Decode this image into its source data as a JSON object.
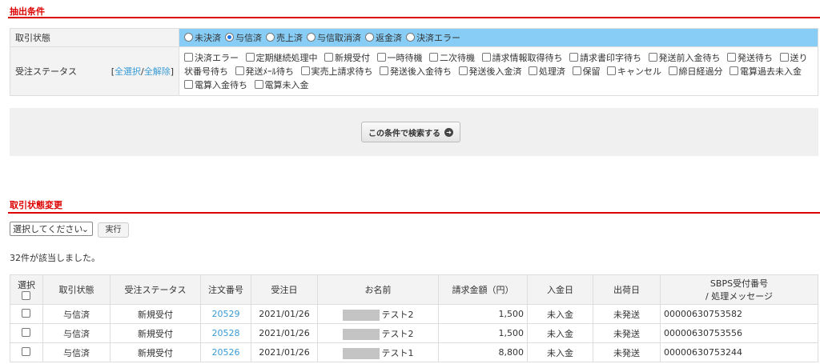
{
  "filter": {
    "title": "抽出条件",
    "trade_label": "取引状態",
    "trade_options": [
      "未決済",
      "与信済",
      "売上済",
      "与信取消済",
      "返金済",
      "決済エラー"
    ],
    "trade_selected": "与信済",
    "status_label": "受注ステータス",
    "select_all": "全選択",
    "deselect_all": "全解除",
    "status_options": [
      "決済エラー",
      "定期継続処理中",
      "新規受付",
      "一時待機",
      "二次待機",
      "請求情報取得待ち",
      "請求書印字待ち",
      "発送前入金待ち",
      "発送待ち",
      "送り状番号待ち",
      "発送ﾒｰﾙ待ち",
      "実売上請求待ち",
      "発送後入金待ち",
      "発送後入金済",
      "処理済",
      "保留",
      "キャンセル",
      "締日経過分",
      "電算過去未入金",
      "電算入金待ち",
      "電算未入金"
    ],
    "search_button": "この条件で検索する"
  },
  "change": {
    "title": "取引状態変更",
    "select_value": "選択してください",
    "exec_button": "実行",
    "count_text": "32件が該当しました。"
  },
  "table": {
    "headers": [
      "選択",
      "取引状態",
      "受注ステータス",
      "注文番号",
      "受注日",
      "お名前",
      "請求金額（円）",
      "入金日",
      "出荷日",
      "SBPS受付番号",
      "/ 処理メッセージ"
    ],
    "rows": [
      {
        "trade": "与信済",
        "status": "新規受付",
        "order": "20529",
        "date": "2021/01/26",
        "name": "テスト2",
        "amount": "1,500",
        "paid": "未入金",
        "ship": "未発送",
        "sbps": "00000630753582"
      },
      {
        "trade": "与信済",
        "status": "新規受付",
        "order": "20528",
        "date": "2021/01/26",
        "name": "テスト2",
        "amount": "1,500",
        "paid": "未入金",
        "ship": "未発送",
        "sbps": "00000630753556"
      },
      {
        "trade": "与信済",
        "status": "新規受付",
        "order": "20526",
        "date": "2021/01/26",
        "name": "テスト1",
        "amount": "8,800",
        "paid": "未入金",
        "ship": "未発送",
        "sbps": "00000630753244"
      }
    ]
  }
}
